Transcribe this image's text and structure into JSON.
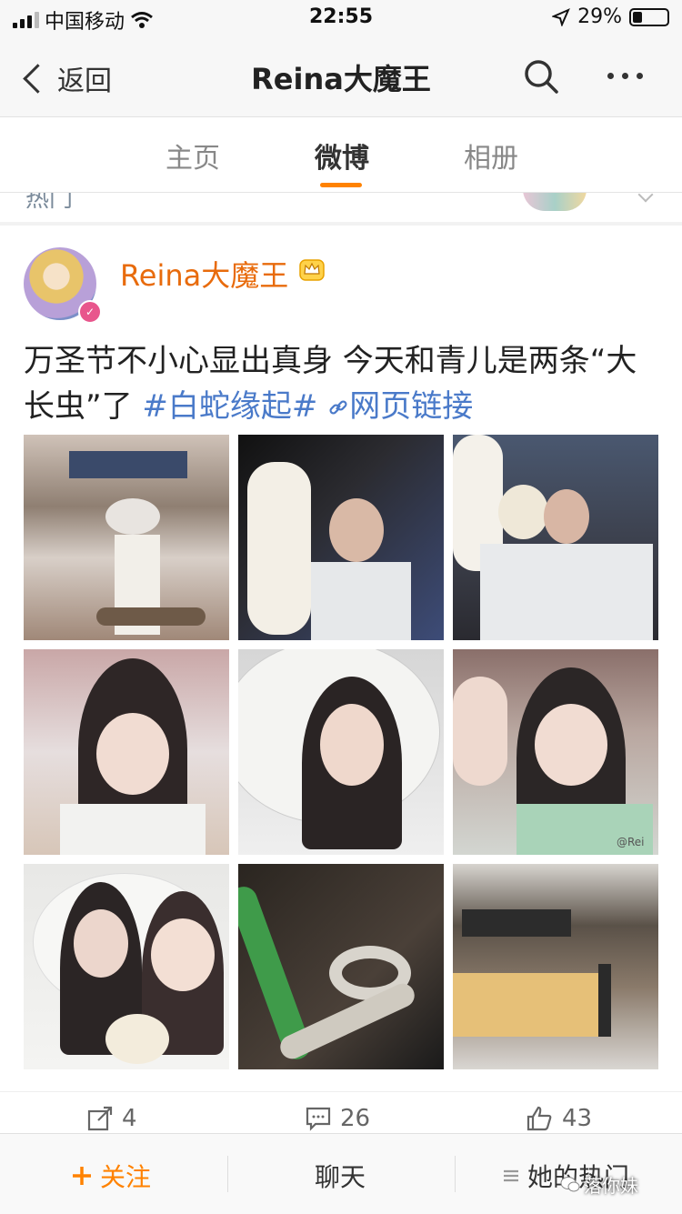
{
  "status_bar": {
    "carrier": "中国移动",
    "time": "22:55",
    "battery_percent": "29%",
    "battery_level": 0.29
  },
  "nav": {
    "back_label": "返回",
    "title": "Reina大魔王"
  },
  "tabs": [
    {
      "label": "主页",
      "active": false
    },
    {
      "label": "微博",
      "active": true
    },
    {
      "label": "相册",
      "active": false
    }
  ],
  "peek": {
    "text": "热门"
  },
  "post": {
    "author": "Reina大魔王",
    "text_main": "万圣节不小心显出真身 今天和青儿是两条“大长虫”了 ",
    "topic": "#白蛇缘起#",
    "link_label": "网页链接",
    "photo_watermark": "@Rei",
    "photos": [
      {
        "name": "photo-1-mall-snake"
      },
      {
        "name": "photo-2-lantern"
      },
      {
        "name": "photo-3-lantern-fan"
      },
      {
        "name": "photo-4-selfie"
      },
      {
        "name": "photo-5-umbrella"
      },
      {
        "name": "photo-6-selfie-duo"
      },
      {
        "name": "photo-7-duo"
      },
      {
        "name": "photo-8-snake-tail"
      },
      {
        "name": "photo-9-food-court"
      }
    ],
    "repost_count": "4",
    "comment_count": "26",
    "like_count": "43"
  },
  "bottom_bar": {
    "follow_label": "关注",
    "chat_label": "聊天",
    "hot_label": "她的热门"
  },
  "watermark": "落你妹",
  "colors": {
    "accent": "#ff8200",
    "username": "#e86b0c",
    "link": "#4a7ac9"
  }
}
